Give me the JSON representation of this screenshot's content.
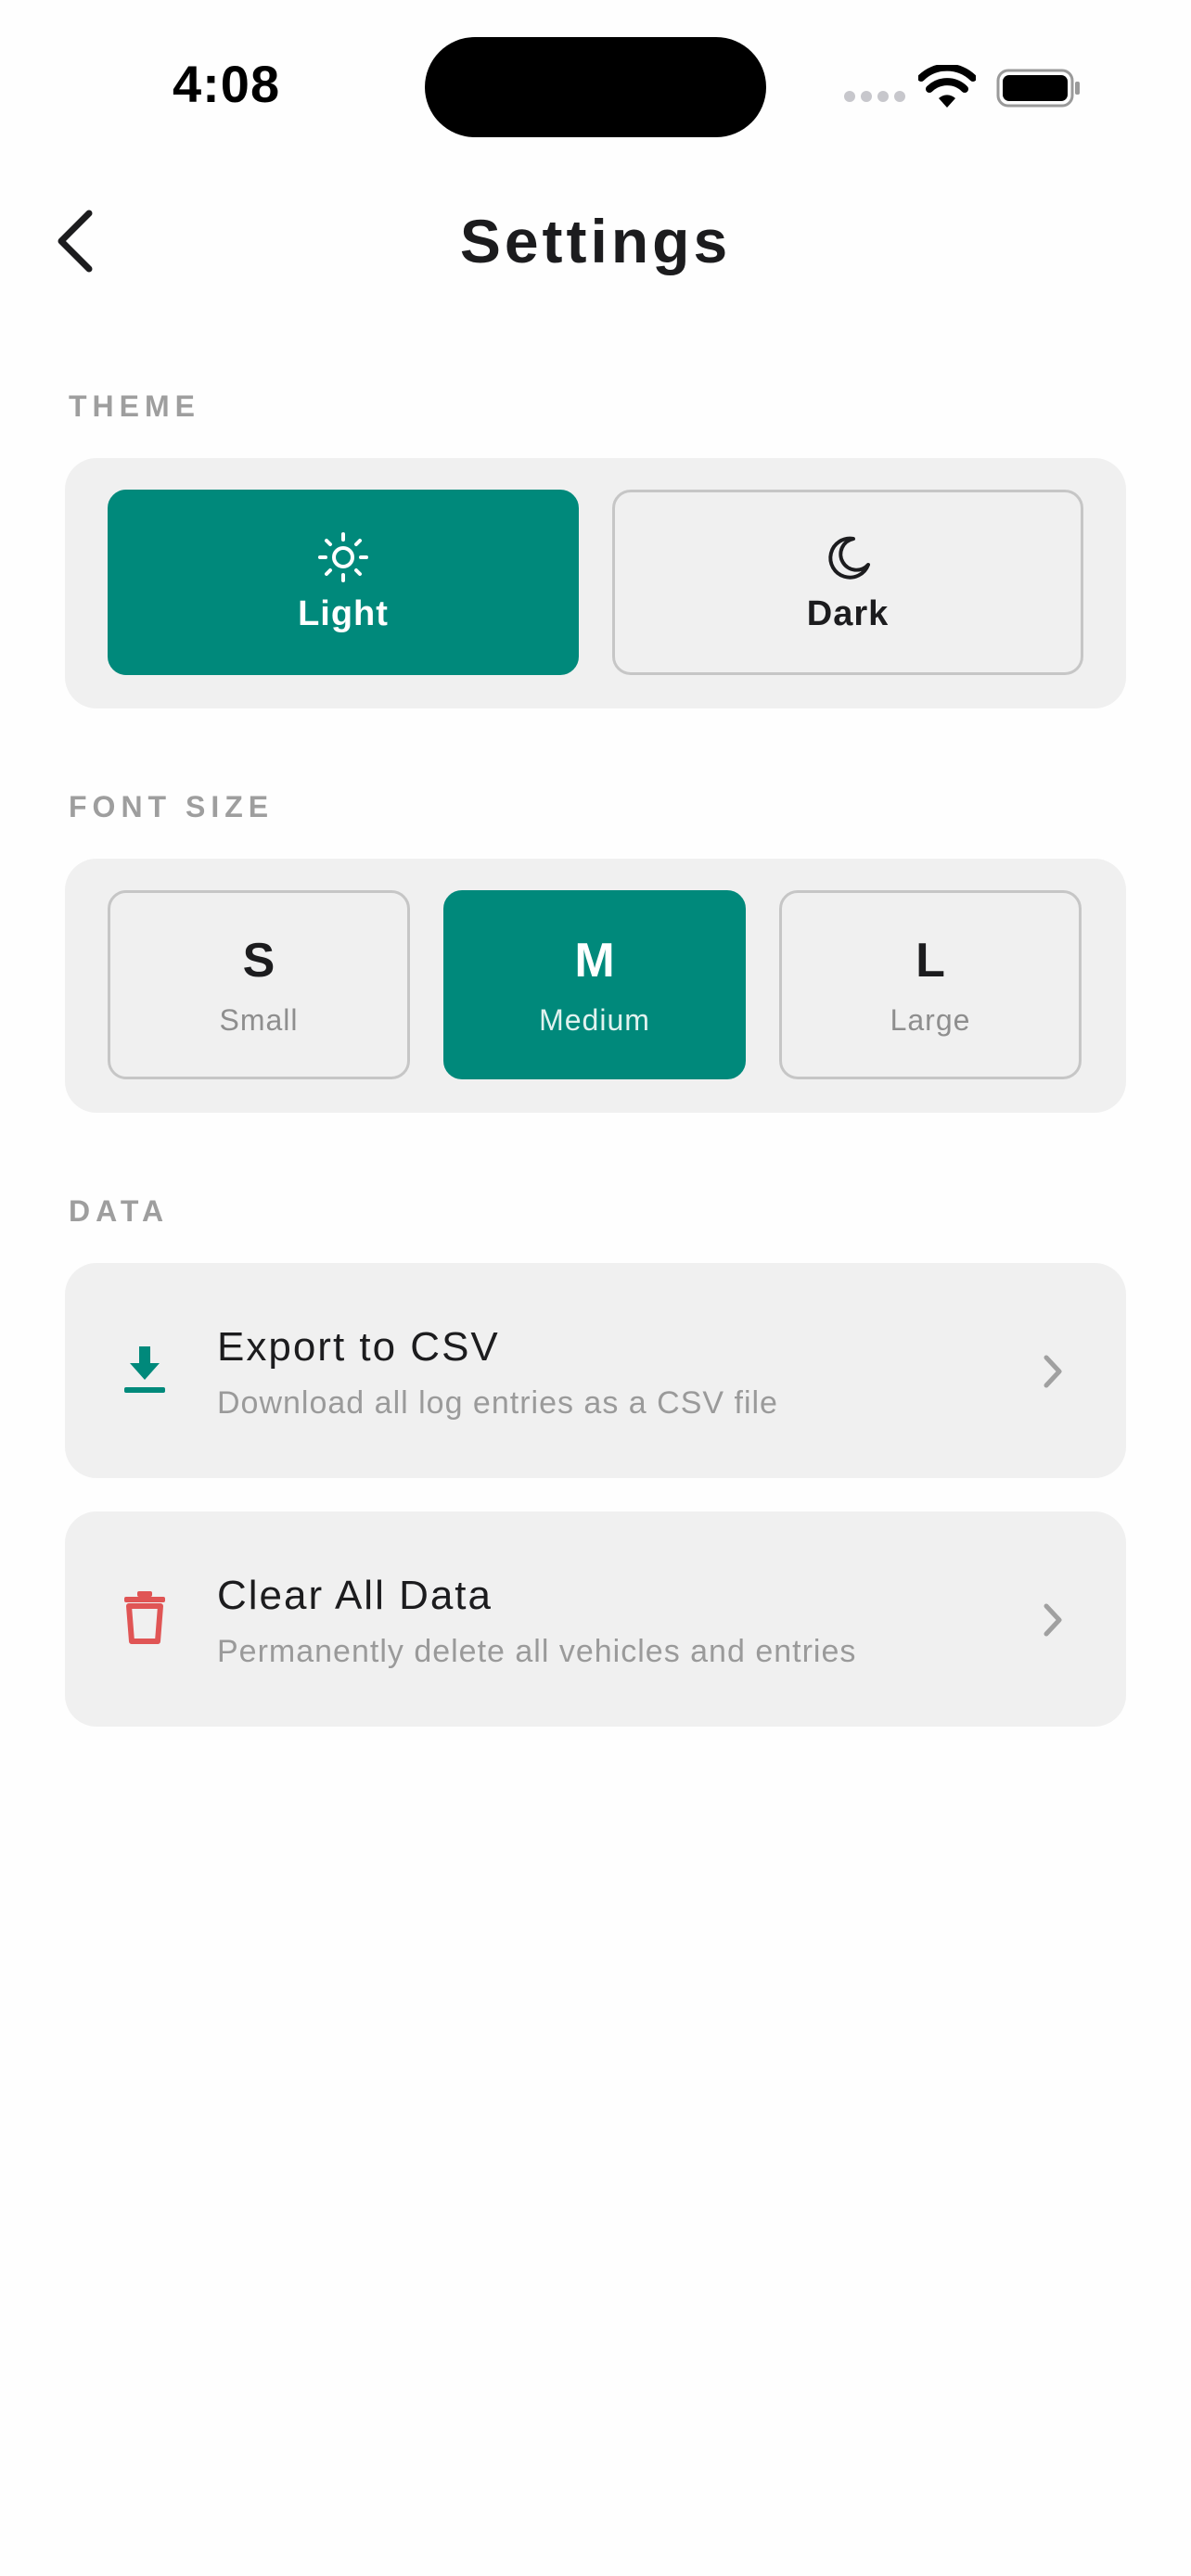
{
  "status_bar": {
    "time": "4:08"
  },
  "header": {
    "title": "Settings"
  },
  "theme": {
    "section_label": "THEME",
    "options": [
      {
        "label": "Light",
        "icon": "sun-icon",
        "selected": true
      },
      {
        "label": "Dark",
        "icon": "moon-icon",
        "selected": false
      }
    ]
  },
  "font_size": {
    "section_label": "FONT SIZE",
    "options": [
      {
        "letter": "S",
        "label": "Small",
        "selected": false
      },
      {
        "letter": "M",
        "label": "Medium",
        "selected": true
      },
      {
        "letter": "L",
        "label": "Large",
        "selected": false
      }
    ]
  },
  "data": {
    "section_label": "DATA",
    "items": [
      {
        "title": "Export to CSV",
        "subtitle": "Download all log entries as a CSV file",
        "icon": "download-icon",
        "icon_color": "#00897b"
      },
      {
        "title": "Clear All Data",
        "subtitle": "Permanently delete all vehicles and entries",
        "icon": "trash-icon",
        "icon_color": "#e05555"
      }
    ]
  },
  "colors": {
    "accent": "#00897b",
    "destructive": "#e05555",
    "card_bg": "#f0f0f0",
    "section_label": "#9e9e9e"
  }
}
